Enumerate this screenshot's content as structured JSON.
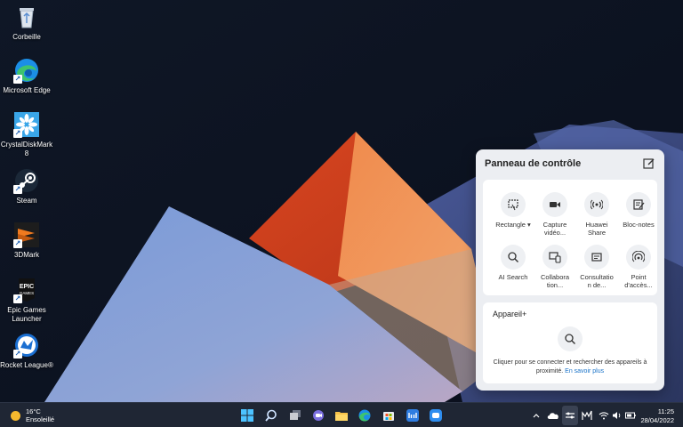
{
  "desktop": {
    "icons": [
      {
        "label": "Corbeille",
        "icon": "recycle-bin-icon"
      },
      {
        "label": "Microsoft Edge",
        "icon": "edge-icon"
      },
      {
        "label": "CrystalDiskMark 8",
        "icon": "crystaldiskmark-icon"
      },
      {
        "label": "Steam",
        "icon": "steam-icon"
      },
      {
        "label": "3DMark",
        "icon": "3dmark-icon"
      },
      {
        "label": "Epic Games\nLauncher",
        "icon": "epic-games-icon",
        "logo_text": "EPIC\nGAMES"
      },
      {
        "label": "Rocket League®",
        "icon": "rocket-league-icon"
      }
    ]
  },
  "panel": {
    "title": "Panneau de contrôle",
    "edit_icon": "edit-icon",
    "tiles": [
      {
        "label": "Rectangle ▾",
        "icon": "screenshot-rectangle-icon"
      },
      {
        "label": "Capture\nvidéo...",
        "icon": "video-capture-icon"
      },
      {
        "label": "Huawei\nShare",
        "icon": "huawei-share-icon"
      },
      {
        "label": "Bloc-notes",
        "icon": "notepad-icon"
      },
      {
        "label": "AI Search",
        "icon": "search-icon"
      },
      {
        "label": "Collabora\ntion...",
        "icon": "collaboration-icon"
      },
      {
        "label": "Consultatio\nn de...",
        "icon": "consultation-icon"
      },
      {
        "label": "Point\nd'accès...",
        "icon": "hotspot-icon"
      }
    ],
    "devices": {
      "title": "Appareil+",
      "description": "Cliquer pour se connecter et rechercher des appareils à proximité.",
      "link": "En savoir plus"
    }
  },
  "taskbar": {
    "weather": {
      "temperature": "16°C",
      "condition": "Ensoleillé"
    },
    "apps": [
      "windows-start-icon",
      "search-icon",
      "task-view-icon",
      "teams-chat-icon",
      "file-explorer-icon",
      "edge-icon",
      "store-icon",
      "huawei-pc-manager-icon",
      "chat-icon"
    ],
    "tray": [
      "chevron-up-icon",
      "onedrive-icon",
      "control-panel-icon",
      "audio-icon",
      "wifi-icon",
      "volume-icon",
      "battery-icon"
    ],
    "time": "11:25",
    "date": "28/04/2022"
  },
  "colors": {
    "accent": "#1a73c8",
    "taskbar": "#1f2634",
    "panel": "#eceef2"
  }
}
